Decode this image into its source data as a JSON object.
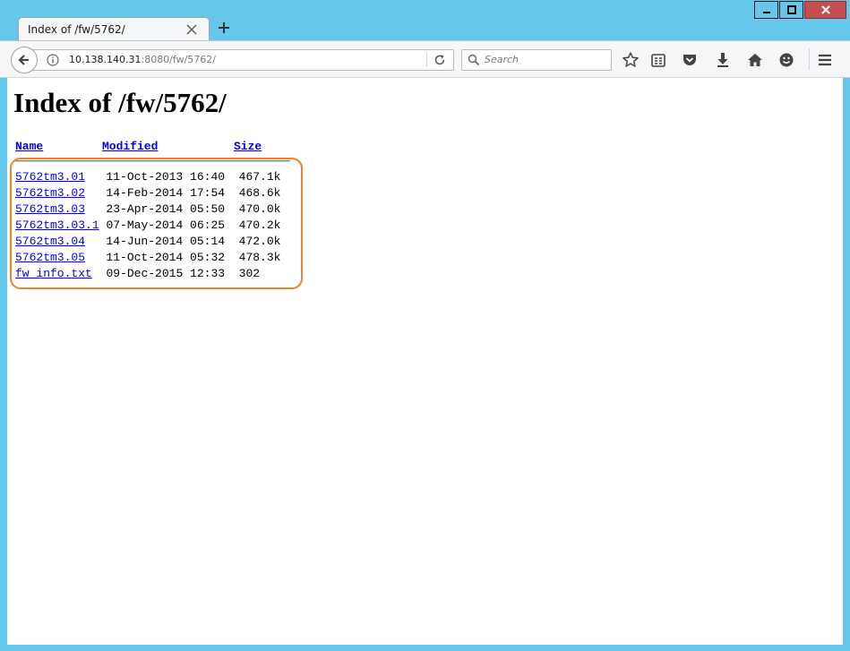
{
  "window": {
    "colors": {
      "frame": "#65c7e9",
      "close_button": "#c44f4f",
      "highlight": "#f0802a",
      "link": "#0000ee"
    }
  },
  "tab": {
    "title": "Index of /fw/5762/"
  },
  "toolbar": {
    "url_host": "10.138.140.31",
    "url_rest": ":8080/fw/5762/",
    "search_placeholder": "Search"
  },
  "page": {
    "title": "Index of /fw/5762/",
    "columns": {
      "name": "Name",
      "modified": "Modified",
      "size": "Size"
    },
    "files": [
      {
        "name": "5762tm3.01",
        "pad": "   ",
        "modified": "11-Oct-2013 16:40",
        "size": "467.1k"
      },
      {
        "name": "5762tm3.02",
        "pad": "   ",
        "modified": "14-Feb-2014 17:54",
        "size": "468.6k"
      },
      {
        "name": "5762tm3.03",
        "pad": "   ",
        "modified": "23-Apr-2014 05:50",
        "size": "470.0k"
      },
      {
        "name": "5762tm3.03.1",
        "pad": " ",
        "modified": "07-May-2014 06:25",
        "size": "470.2k"
      },
      {
        "name": "5762tm3.04",
        "pad": "   ",
        "modified": "14-Jun-2014 05:14",
        "size": "472.0k"
      },
      {
        "name": "5762tm3.05",
        "pad": "   ",
        "modified": "11-Oct-2014 05:32",
        "size": "478.3k"
      },
      {
        "name": "fw_info.txt",
        "pad": "  ",
        "modified": "09-Dec-2015 12:33",
        "size": "302"
      }
    ]
  }
}
